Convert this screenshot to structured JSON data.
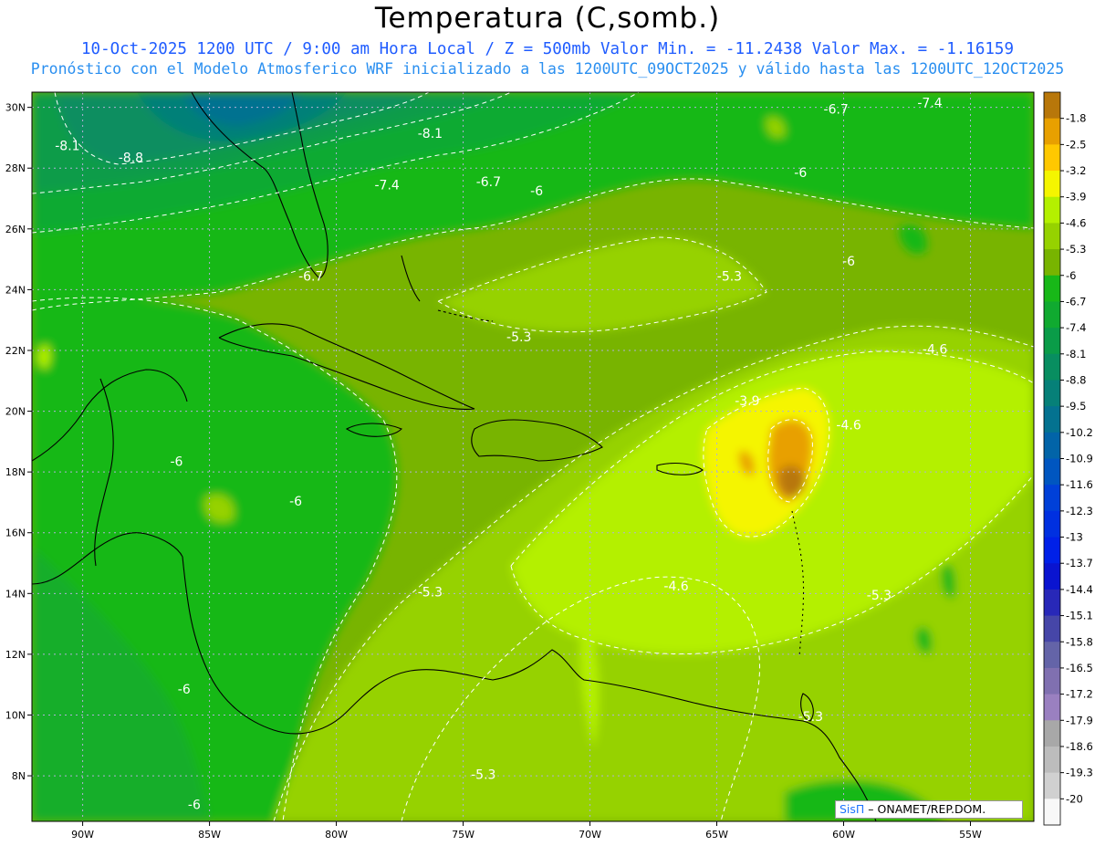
{
  "header": {
    "title": "Temperatura (C,somb.)",
    "line1": "10-Oct-2025  1200 UTC / 9:00 am Hora Local / Z = 500mb  Valor Min. = -11.2438  Valor Max. = -1.16159",
    "line2": "Pronóstico con el Modelo Atmosferico WRF inicializado a las 1200UTC_09OCT2025 y válido hasta las  1200UTC_12OCT2025"
  },
  "map": {
    "lon_range": [
      -92.0,
      -52.5
    ],
    "lat_range": [
      6.5,
      30.5
    ],
    "lon_ticks": [
      "90W",
      "85W",
      "80W",
      "75W",
      "70W",
      "65W",
      "60W",
      "55W"
    ],
    "lat_ticks": [
      "30N",
      "28N",
      "26N",
      "24N",
      "22N",
      "20N",
      "18N",
      "16N",
      "14N",
      "12N",
      "10N",
      "8N"
    ],
    "grid": true,
    "contour_labels": [
      {
        "text": "-8.1",
        "lon": -90.6,
        "lat": 28.6
      },
      {
        "text": "-8.8",
        "lon": -88.1,
        "lat": 28.2
      },
      {
        "text": "-8.1",
        "lon": -76.3,
        "lat": 29.0
      },
      {
        "text": "-7.4",
        "lon": -78.0,
        "lat": 27.3
      },
      {
        "text": "-6.7",
        "lon": -74.0,
        "lat": 27.4
      },
      {
        "text": "-6",
        "lon": -72.1,
        "lat": 27.1
      },
      {
        "text": "-6.7",
        "lon": -60.3,
        "lat": 29.8
      },
      {
        "text": "-7.4",
        "lon": -56.6,
        "lat": 30.0
      },
      {
        "text": "-6",
        "lon": -61.7,
        "lat": 27.7
      },
      {
        "text": "-6.7",
        "lon": -92.5,
        "lat": 24.7
      },
      {
        "text": "-6.7",
        "lon": -81.0,
        "lat": 24.3
      },
      {
        "text": "-5.3",
        "lon": -64.5,
        "lat": 24.3
      },
      {
        "text": "-6",
        "lon": -59.8,
        "lat": 24.8
      },
      {
        "text": "-5.3",
        "lon": -72.8,
        "lat": 22.3
      },
      {
        "text": "-4.6",
        "lon": -56.4,
        "lat": 21.9
      },
      {
        "text": "-3.9",
        "lon": -63.8,
        "lat": 20.2
      },
      {
        "text": "-4.6",
        "lon": -59.8,
        "lat": 19.4
      },
      {
        "text": "-6",
        "lon": -86.3,
        "lat": 18.2
      },
      {
        "text": "-6",
        "lon": -81.6,
        "lat": 16.9
      },
      {
        "text": "-5.3",
        "lon": -76.3,
        "lat": 13.9
      },
      {
        "text": "-4.6",
        "lon": -66.6,
        "lat": 14.1
      },
      {
        "text": "-5.3",
        "lon": -58.6,
        "lat": 13.8
      },
      {
        "text": "-6",
        "lon": -86.0,
        "lat": 10.7
      },
      {
        "text": "-5.3",
        "lon": -61.3,
        "lat": 9.8
      },
      {
        "text": "-5.3",
        "lon": -74.2,
        "lat": 7.9
      },
      {
        "text": "-6",
        "lon": -85.6,
        "lat": 6.9
      }
    ]
  },
  "colorbar": {
    "levels": [
      "-1.8",
      "-2.5",
      "-3.2",
      "-3.9",
      "-4.6",
      "-5.3",
      "-6",
      "-6.7",
      "-7.4",
      "-8.1",
      "-8.8",
      "-9.5",
      "-10.2",
      "-10.9",
      "-11.6",
      "-12.3",
      "-13",
      "-13.7",
      "-14.4",
      "-15.1",
      "-15.8",
      "-16.5",
      "-17.2",
      "-17.9",
      "-18.6",
      "-19.3",
      "-20"
    ],
    "colors": [
      "#b8770a",
      "#e8a000",
      "#ffc800",
      "#f5f500",
      "#b4f000",
      "#96d200",
      "#78b400",
      "#18b818",
      "#10aa30",
      "#0a9c48",
      "#088e60",
      "#068078",
      "#047290",
      "#0264a8",
      "#0056c0",
      "#0040d8",
      "#0030e0",
      "#0020e8",
      "#0a14d0",
      "#2828b8",
      "#4646a8",
      "#6464a8",
      "#8070b0",
      "#9a80c0",
      "#a8a8a8",
      "#bcbcbc",
      "#d0d0d0",
      "#f8f8f8"
    ]
  },
  "credit": {
    "logo": "SisΠ",
    "org": " – ONAMET/REP.DOM."
  }
}
